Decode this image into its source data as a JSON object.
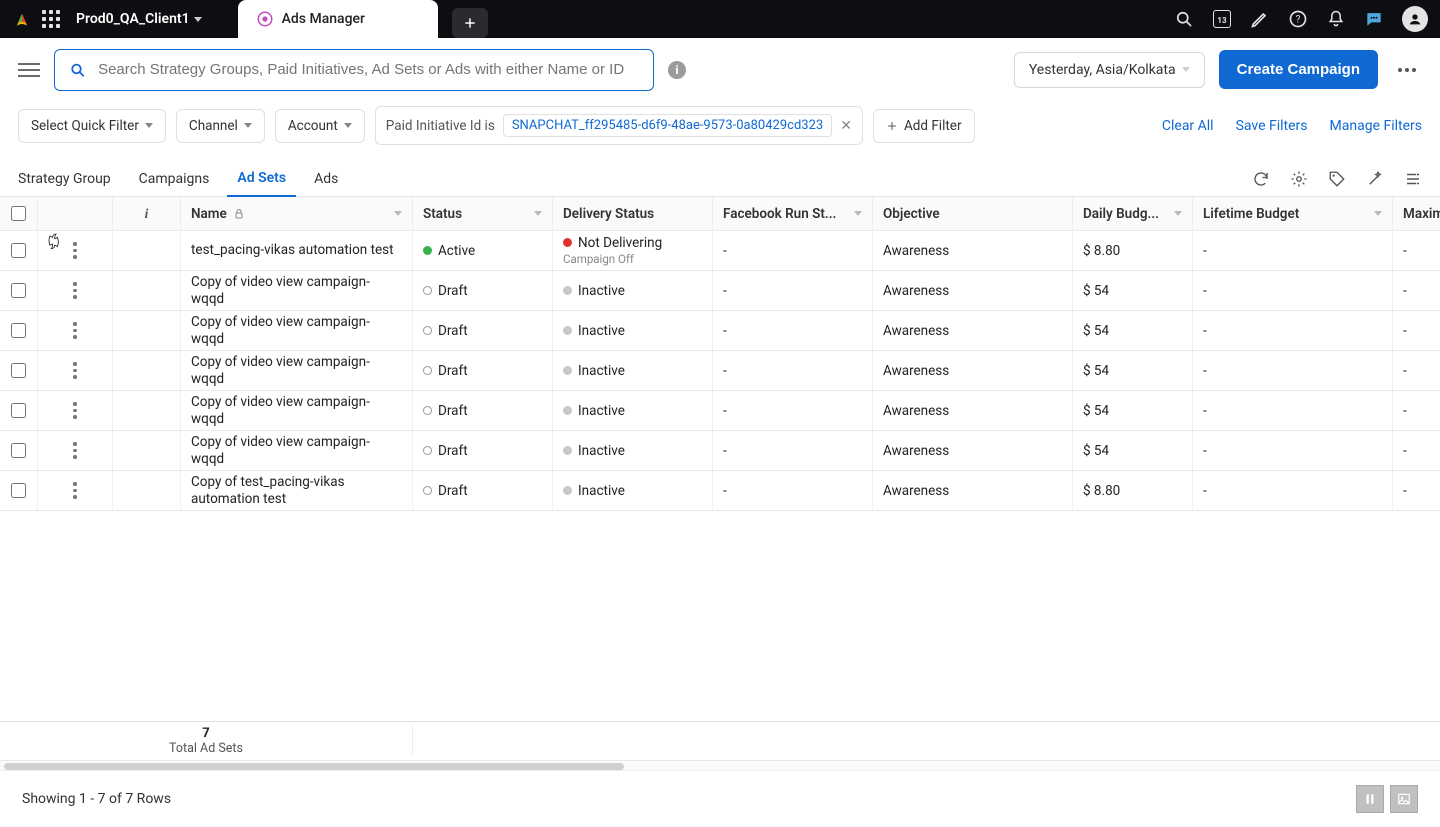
{
  "header": {
    "client": "Prod0_QA_Client1",
    "tab_title": "Ads Manager",
    "calendar_badge": "13"
  },
  "subheader": {
    "search_placeholder": "Search Strategy Groups, Paid Initiatives, Ad Sets or Ads with either Name or ID",
    "date_label": "Yesterday, Asia/Kolkata",
    "create_label": "Create Campaign"
  },
  "filters": {
    "quick_filter": "Select Quick Filter",
    "channel": "Channel",
    "account": "Account",
    "applied": {
      "label": "Paid Initiative Id is",
      "value": "SNAPCHAT_ff295485-d6f9-48ae-9573-0a80429cd323"
    },
    "add_filter": "Add Filter",
    "links": [
      "Clear All",
      "Save Filters",
      "Manage Filters"
    ]
  },
  "tabs": [
    "Strategy Group",
    "Campaigns",
    "Ad Sets",
    "Ads"
  ],
  "active_tab": "Ad Sets",
  "table": {
    "headers": {
      "name": "Name",
      "status": "Status",
      "delivery": "Delivery Status",
      "fb": "Facebook Run St...",
      "objective": "Objective",
      "daily": "Daily Budg...",
      "lifetime": "Lifetime Budget",
      "max": "Maxim"
    },
    "rows": [
      {
        "name": "test_pacing-vikas automation test",
        "status": "Active",
        "status_type": "green",
        "delivery": "Not Delivering",
        "delivery_sub": "Campaign Off",
        "delivery_dot": "red",
        "fb": "-",
        "objective": "Awareness",
        "daily": "$ 8.80",
        "lifetime": "-",
        "max": "-"
      },
      {
        "name": "Copy of video view campaign-wqqd",
        "status": "Draft",
        "status_type": "hollow",
        "delivery": "Inactive",
        "delivery_sub": "",
        "delivery_dot": "gray",
        "fb": "-",
        "objective": "Awareness",
        "daily": "$ 54",
        "lifetime": "-",
        "max": "-"
      },
      {
        "name": "Copy of video view campaign-wqqd",
        "status": "Draft",
        "status_type": "hollow",
        "delivery": "Inactive",
        "delivery_sub": "",
        "delivery_dot": "gray",
        "fb": "-",
        "objective": "Awareness",
        "daily": "$ 54",
        "lifetime": "-",
        "max": "-"
      },
      {
        "name": "Copy of video view campaign-wqqd",
        "status": "Draft",
        "status_type": "hollow",
        "delivery": "Inactive",
        "delivery_sub": "",
        "delivery_dot": "gray",
        "fb": "-",
        "objective": "Awareness",
        "daily": "$ 54",
        "lifetime": "-",
        "max": "-"
      },
      {
        "name": "Copy of video view campaign-wqqd",
        "status": "Draft",
        "status_type": "hollow",
        "delivery": "Inactive",
        "delivery_sub": "",
        "delivery_dot": "gray",
        "fb": "-",
        "objective": "Awareness",
        "daily": "$ 54",
        "lifetime": "-",
        "max": "-"
      },
      {
        "name": "Copy of video view campaign-wqqd",
        "status": "Draft",
        "status_type": "hollow",
        "delivery": "Inactive",
        "delivery_sub": "",
        "delivery_dot": "gray",
        "fb": "-",
        "objective": "Awareness",
        "daily": "$ 54",
        "lifetime": "-",
        "max": "-"
      },
      {
        "name": "Copy of test_pacing-vikas automation test",
        "status": "Draft",
        "status_type": "hollow",
        "delivery": "Inactive",
        "delivery_sub": "",
        "delivery_dot": "gray",
        "fb": "-",
        "objective": "Awareness",
        "daily": "$ 8.80",
        "lifetime": "-",
        "max": "-"
      }
    ],
    "footer": {
      "count": "7",
      "label": "Total Ad Sets"
    },
    "showing": "Showing 1 - 7 of 7 Rows"
  }
}
